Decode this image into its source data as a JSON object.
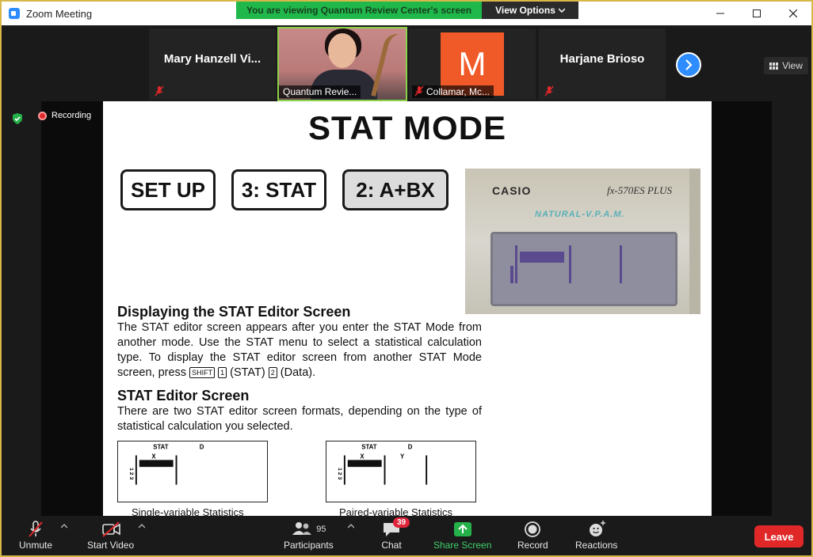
{
  "window": {
    "title": "Zoom Meeting"
  },
  "banner": {
    "viewing_text": "You are viewing Quantum Review Center's screen",
    "view_options_label": "View Options"
  },
  "gallery": {
    "tiles": [
      {
        "name": "Mary Hanzell Vi..."
      },
      {
        "label": "Quantum Revie..."
      },
      {
        "avatar_letter": "M",
        "label": "Collamar, Mc..."
      },
      {
        "name": "Harjane Brioso"
      }
    ],
    "view_label": "View"
  },
  "recording": {
    "label": "Recording"
  },
  "slide": {
    "title": "STAT MODE",
    "steps": [
      "SET UP",
      "3: STAT",
      "2: A+BX"
    ],
    "calculator": {
      "brand": "CASIO",
      "model": "fx-570ES PLUS",
      "tagline": "NATURAL-V.P.A.M."
    },
    "heading1": "Displaying the STAT Editor Screen",
    "para1_a": "The STAT editor screen appears after you enter the STAT Mode from another mode. Use the STAT menu to select a statistical calculation type. To display the STAT editor screen from another STAT Mode screen, press",
    "key_shift": "SHIFT",
    "key_1": "1",
    "para1_b": "(STAT)",
    "key_2": "2",
    "para1_c": "(Data).",
    "heading2": "STAT Editor Screen",
    "para2": "There are two STAT editor screen formats, depending on the type of statistical calculation you selected.",
    "lcd_stat": "STAT",
    "lcd_d": "D",
    "lcd_x": "X",
    "lcd_y": "Y",
    "lcd_rows": "1 2 3",
    "caption1": "Single-variable Statistics",
    "caption2": "Paired-variable Statistics"
  },
  "toolbar": {
    "unmute": "Unmute",
    "start_video": "Start Video",
    "participants_count": "95",
    "participants": "Participants",
    "chat": "Chat",
    "chat_badge": "39",
    "share_screen": "Share Screen",
    "record": "Record",
    "reactions": "Reactions",
    "leave": "Leave"
  },
  "colors": {
    "accent_green": "#20b84a",
    "zoom_blue": "#2d8cff",
    "leave_red": "#e02828"
  }
}
